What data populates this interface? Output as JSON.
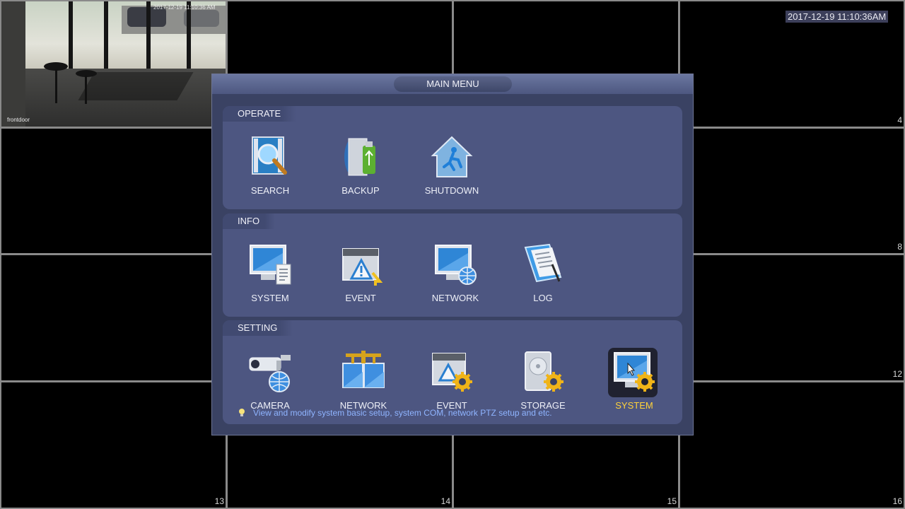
{
  "timestamp": "2017-12-19 11:10:36AM",
  "camera_feed": {
    "label": "frontdoor",
    "overlay_time": "2017-12-19 11:10:36 AM"
  },
  "channels": {
    "ch4": "4",
    "ch8": "8",
    "ch12": "12",
    "ch13": "13",
    "ch14": "14",
    "ch15": "15",
    "ch16": "16"
  },
  "dialog": {
    "title": "MAIN MENU",
    "sections": [
      {
        "label": "OPERATE",
        "items": [
          {
            "label": "SEARCH",
            "icon": "search-icon"
          },
          {
            "label": "BACKUP",
            "icon": "backup-icon"
          },
          {
            "label": "SHUTDOWN",
            "icon": "shutdown-icon"
          }
        ]
      },
      {
        "label": "INFO",
        "items": [
          {
            "label": "SYSTEM",
            "icon": "system-info-icon"
          },
          {
            "label": "EVENT",
            "icon": "event-info-icon"
          },
          {
            "label": "NETWORK",
            "icon": "network-info-icon"
          },
          {
            "label": "LOG",
            "icon": "log-icon"
          }
        ]
      },
      {
        "label": "SETTING",
        "items": [
          {
            "label": "CAMERA",
            "icon": "camera-icon"
          },
          {
            "label": "NETWORK",
            "icon": "network-setting-icon"
          },
          {
            "label": "EVENT",
            "icon": "event-setting-icon"
          },
          {
            "label": "STORAGE",
            "icon": "storage-icon"
          },
          {
            "label": "SYSTEM",
            "icon": "system-setting-icon",
            "selected": true
          }
        ]
      }
    ],
    "hint": "View and modify system basic setup, system COM, network PTZ setup and etc."
  },
  "colors": {
    "dialog_bg": "#3a4263",
    "section_bg": "#4d5681",
    "selected_label": "#ffd23a",
    "hint_text": "#8fb4ff"
  }
}
